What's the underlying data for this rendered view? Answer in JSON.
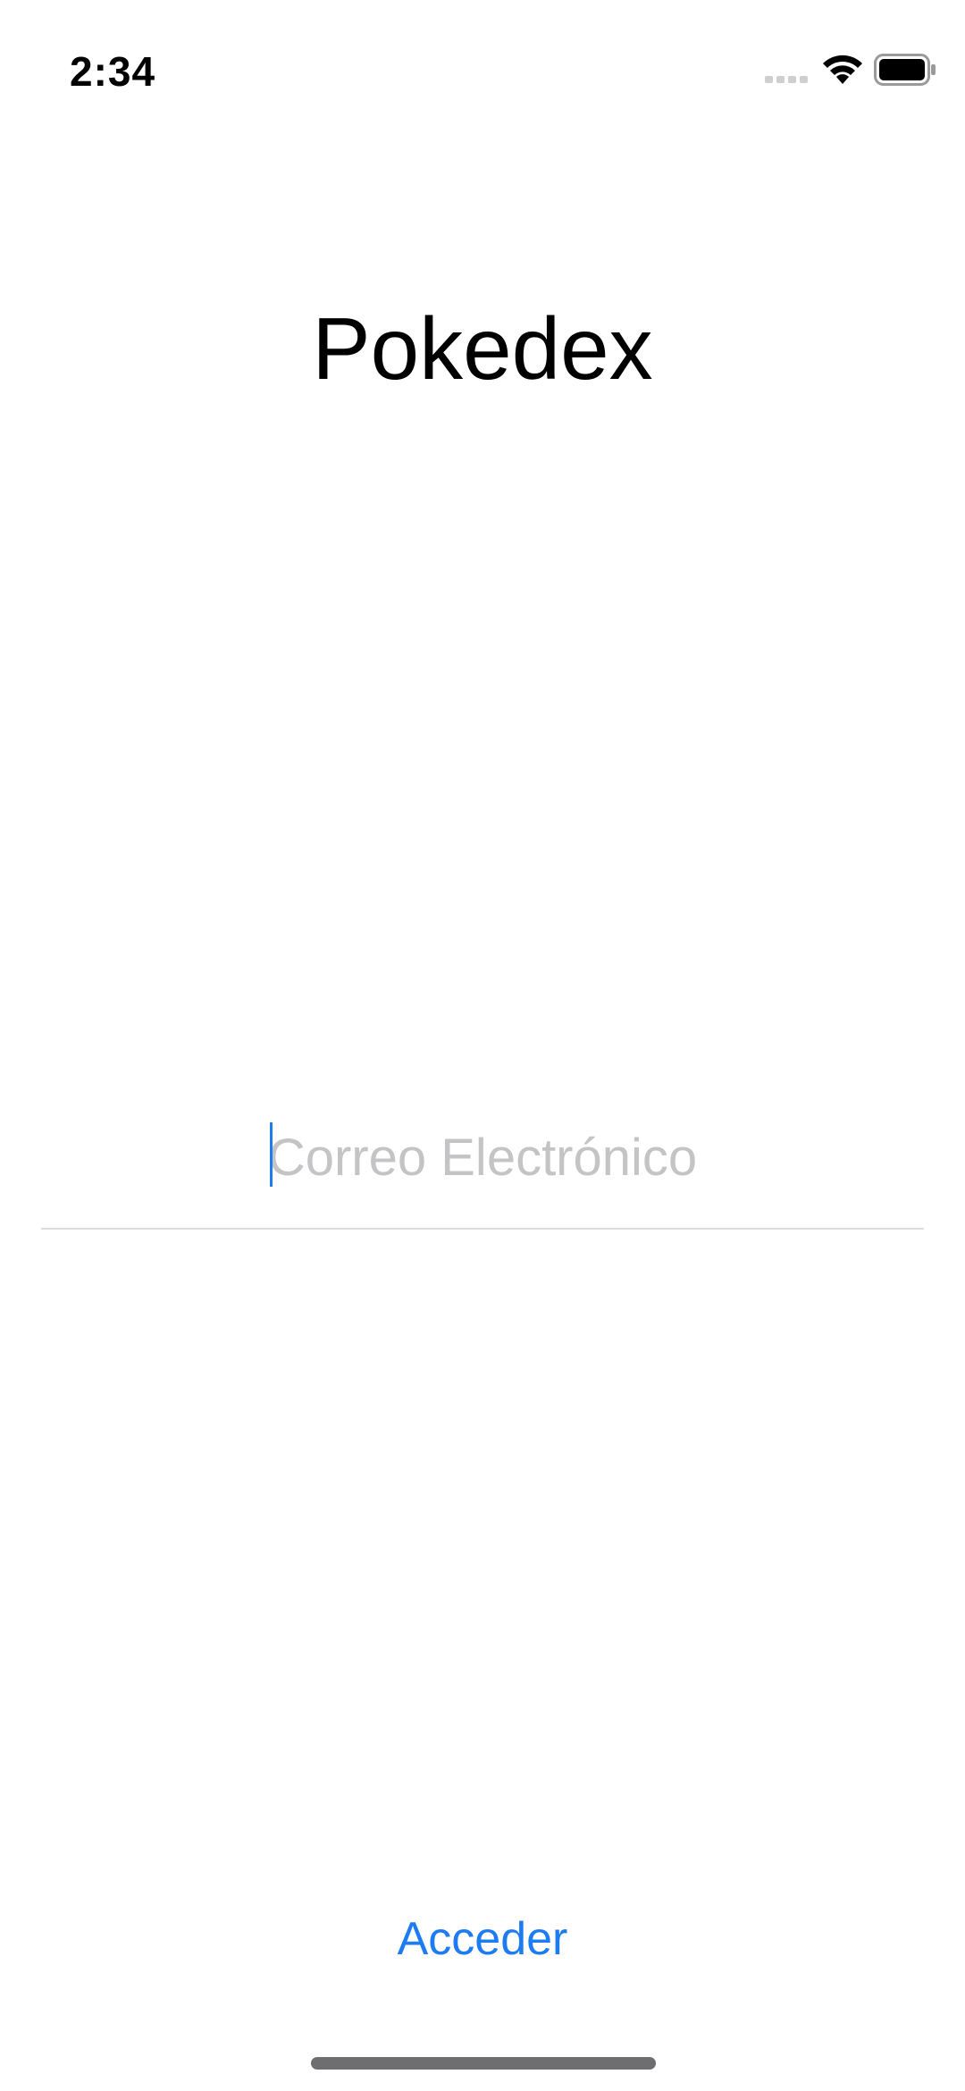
{
  "status_bar": {
    "time": "2:34",
    "signal_icon": "cellular-signal-icon",
    "wifi_icon": "wifi-icon",
    "battery_icon": "battery-icon"
  },
  "app": {
    "title": "Pokedex"
  },
  "login_form": {
    "email_placeholder": "Correo Electrónico",
    "email_value": "",
    "submit_label": "Acceder"
  },
  "colors": {
    "accent": "#1e7cf2",
    "placeholder": "#c4c4c6",
    "divider": "#dcdcdc",
    "text": "#000000",
    "background": "#ffffff"
  }
}
